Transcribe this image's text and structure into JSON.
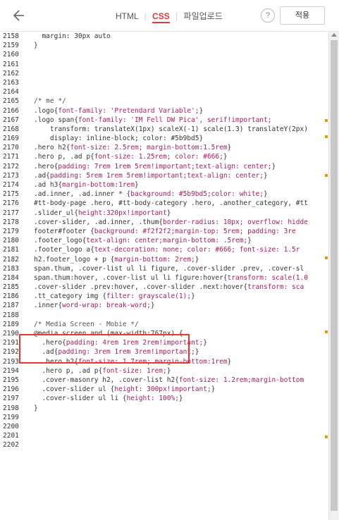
{
  "header": {
    "tabs": [
      {
        "label": "HTML"
      },
      {
        "label": "CSS"
      },
      {
        "label": "파일업로드"
      }
    ],
    "help": "?",
    "apply": "적용"
  },
  "accent_color": "#e53935",
  "line_numbers": [
    "2158",
    "2159",
    "2160",
    "2161",
    "2162",
    "2163",
    "2164",
    "2165",
    "2166",
    "2167",
    "2168",
    "2169",
    "2170",
    "2171",
    "2172",
    "2173",
    "2174",
    "2175",
    "2176",
    "2177",
    "2178",
    "2179",
    "2180",
    "2181",
    "2182",
    "2183",
    "2184",
    "2185",
    "2186",
    "2187",
    "2188",
    "2189",
    "2190",
    "2191",
    "2192",
    "2193",
    "2194",
    "2195",
    "2196",
    "2197",
    "2198",
    "2199",
    "2200",
    "2201",
    "2202"
  ],
  "code_lines": [
    "  margin: 30px auto",
    "}",
    "",
    "",
    "",
    "",
    "",
    "/* me */",
    ".logo{font-family: 'Pretendard Variable';}",
    ".logo span{font-family: 'IM Fell DW Pica', serif!important;",
    "    transform: translateX(1px) scaleX(-1) scale(1.3) translateY(2px)",
    "    display: inline-block; color: #5b9bd5}",
    ".hero h2{font-size: 2.5rem; margin-bottom:1.5rem}",
    ".hero p, .ad p{font-size: 1.25rem; color: #666;}",
    ".hero{padding: 7rem 1rem 5rem!important;text-align: center;}",
    ".ad{padding: 5rem 1rem 5rem!important;text-align: center;}",
    ".ad h3{margin-bottom:1rem}",
    ".ad.inner, .ad.inner * {background: #5b9bd5;color: white;}",
    "#tt-body-page .hero, #tt-body-category .hero, .another_category, #tt",
    ".slider_ul{height:320px!important}",
    ".cover-slider, .ad.inner, .thum{border-radius: 10px; overflow: hidde",
    "footer#footer {background: #f2f2f2;margin-top: 5rem; padding: 3re",
    ".footer_logo{text-align: center;margin-bottom: .5rem;}",
    ".footer_logo a{text-decoration: none; color: #666; font-size: 1.5r",
    "h2.footer_logo + p {margin-bottom: 2rem;}",
    "span.thum, .cover-list ul li figure, .cover-slider .prev, .cover-sl",
    "span.thum:hover, .cover-list ul li figure:hover{transform: scale(1.0",
    ".cover-slider .prev:hover, .cover-slider .next:hover{transform: sca",
    ".tt_category img {filter: grayscale(1);}",
    ".inner{word-wrap: break-word;}",
    "",
    "/* Media Screen - Mobie */",
    "@media screen and (max-width:767px) {",
    "  .hero{padding: 4rem 1rem 2rem!important;}",
    "  .ad{padding: 3rem 1rem 3rem!important;}",
    "  .hero h2{font-size: 1.7rem; margin-bottom:1rem}",
    "  .hero p, .ad p{font-size: 1rem;}",
    "  .cover-masonry h2, .cover-list h2{font-size: 1.2rem;margin-bottom",
    "  .cover-slider ul {height: 300px!important;}",
    "  .cover-slider ul li {height: 100%;}",
    "}",
    "",
    "",
    "",
    ""
  ],
  "swatches": {
    "blue": "#5b9bd5",
    "grey": "#666666",
    "white": "#ffffff",
    "light": "#f2f2f2"
  }
}
